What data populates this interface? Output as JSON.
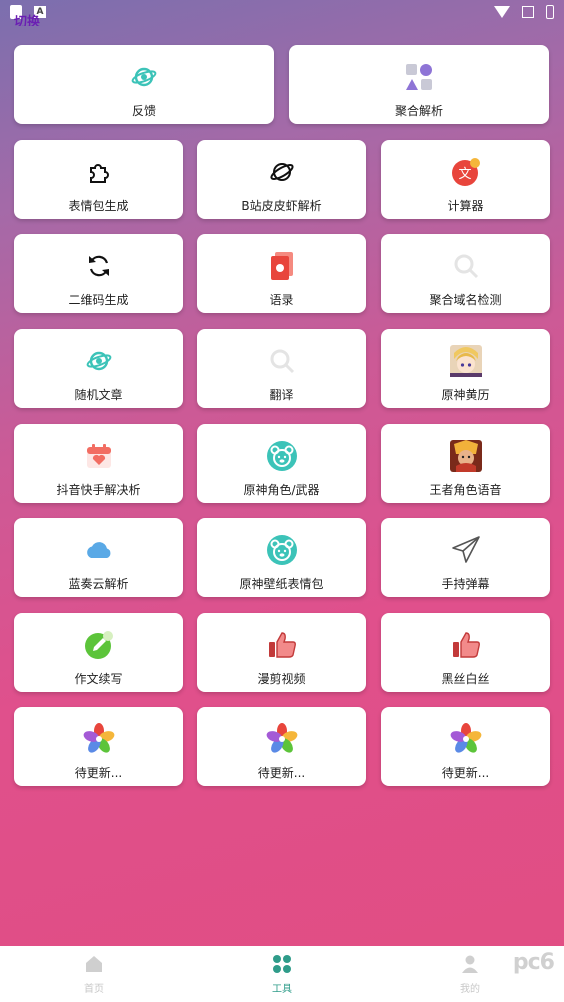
{
  "status_bar": {
    "left_icons": [
      "clipboard-icon",
      "font-app-icon"
    ],
    "right_icons": [
      "wifi-icon",
      "no-sim-icon",
      "battery-icon"
    ]
  },
  "header_peek": "切换",
  "top_row": [
    {
      "label": "反馈",
      "icon": "feedback-planet-icon"
    },
    {
      "label": "聚合解析",
      "icon": "shapes-icon"
    }
  ],
  "grid": [
    {
      "label": "表情包生成",
      "icon": "puzzle-icon"
    },
    {
      "label": "B站皮皮虾解析",
      "icon": "planet-outline-icon"
    },
    {
      "label": "计算器",
      "icon": "translate-badge-icon"
    },
    {
      "label": "二维码生成",
      "icon": "refresh-icon"
    },
    {
      "label": "语录",
      "icon": "red-card-icon"
    },
    {
      "label": "聚合域名检测",
      "icon": "search-icon"
    },
    {
      "label": "随机文章",
      "icon": "planet-icon"
    },
    {
      "label": "翻译",
      "icon": "search-icon"
    },
    {
      "label": "原神黄历",
      "icon": "anime-avatar-icon"
    },
    {
      "label": "抖音快手解决析",
      "icon": "calendar-heart-icon"
    },
    {
      "label": "原神角色/武器",
      "icon": "bear-icon"
    },
    {
      "label": "王者角色语音",
      "icon": "hero-avatar-icon"
    },
    {
      "label": "蓝奏云解析",
      "icon": "cloud-icon"
    },
    {
      "label": "原神壁纸表情包",
      "icon": "bear-icon"
    },
    {
      "label": "手持弹幕",
      "icon": "paper-plane-icon"
    },
    {
      "label": "作文续写",
      "icon": "pen-badge-icon"
    },
    {
      "label": "漫剪视频",
      "icon": "thumbs-up-icon"
    },
    {
      "label": "黑丝白丝",
      "icon": "thumbs-up-icon"
    },
    {
      "label": "待更新...",
      "icon": "pinwheel-icon"
    },
    {
      "label": "待更新...",
      "icon": "pinwheel-icon"
    },
    {
      "label": "待更新...",
      "icon": "pinwheel-icon"
    }
  ],
  "bottom_nav": [
    {
      "label": "首页",
      "icon": "home-icon",
      "active": false
    },
    {
      "label": "工具",
      "icon": "grid-icon",
      "active": true
    },
    {
      "label": "我的",
      "icon": "user-icon",
      "active": false
    }
  ],
  "watermark": "pc6",
  "colors": {
    "accent": "#2f9c8a",
    "teal_icon": "#3cc3b8",
    "red_icon": "#e8453c"
  }
}
